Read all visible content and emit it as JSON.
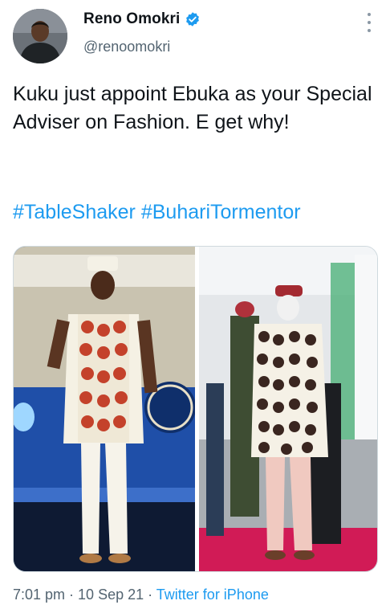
{
  "author": {
    "display_name": "Reno Omokri",
    "handle": "@renoomokri",
    "verified": true,
    "avatar_icon": "user-avatar"
  },
  "menu": {
    "icon": "more-options-icon"
  },
  "tweet": {
    "text": "Kuku just appoint Ebuka as your Special Adviser on Fashion. E get why!",
    "hashtags": [
      "#TableShaker",
      "#BuhariTormentor"
    ]
  },
  "media": {
    "left_photo_icon": "photo-man-on-stage",
    "right_photo_icon": "photo-man-on-red-carpet"
  },
  "meta": {
    "time": "7:01 pm",
    "separator": " · ",
    "date": "10 Sep 21",
    "source": "Twitter for iPhone"
  },
  "colors": {
    "link": "#1d9bf0",
    "secondary_text": "#536471",
    "verified_badge": "#1d9bf0",
    "carpet": "#d11b56"
  }
}
